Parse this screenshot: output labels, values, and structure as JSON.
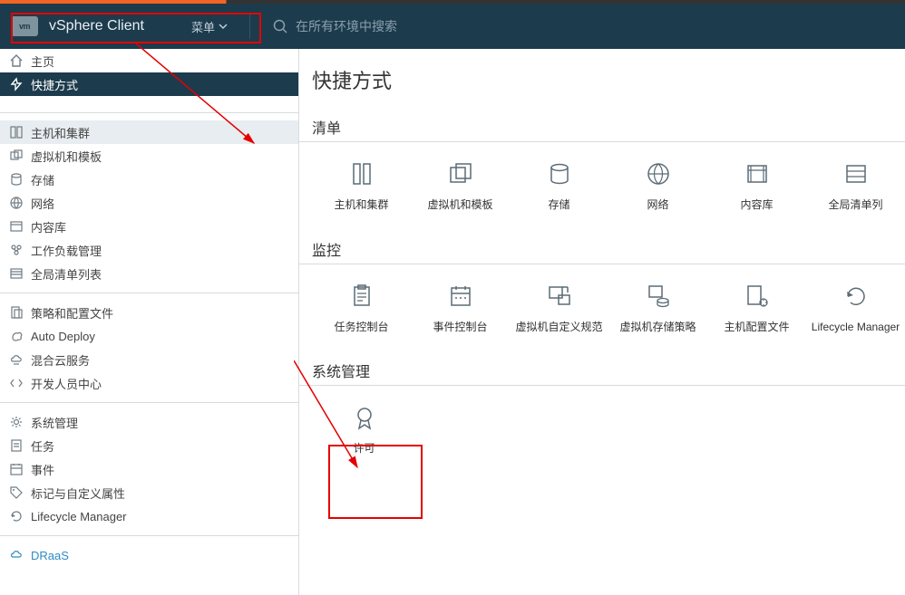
{
  "header": {
    "logo_text": "vm",
    "brand": "vSphere Client",
    "menu_label": "菜单",
    "search_placeholder": "在所有环境中搜索"
  },
  "sidebar": {
    "home": "主页",
    "shortcuts": "快捷方式",
    "hosts": "主机和集群",
    "vms": "虚拟机和模板",
    "storage": "存储",
    "network": "网络",
    "contentlib": "内容库",
    "workload": "工作负载管理",
    "globallists": "全局清单列表",
    "policies": "策略和配置文件",
    "autodeploy": "Auto Deploy",
    "hybrid": "混合云服务",
    "devcenter": "开发人员中心",
    "sysadmin": "系统管理",
    "tasks": "任务",
    "events": "事件",
    "tags": "标记与自定义属性",
    "lifecycle": "Lifecycle Manager",
    "draas": "DRaaS"
  },
  "main": {
    "title": "快捷方式",
    "section_inventory": "清单",
    "section_monitor": "监控",
    "section_admin": "系统管理",
    "tiles_inventory": {
      "hosts": "主机和集群",
      "vms": "虚拟机和模板",
      "storage": "存储",
      "network": "网络",
      "contentlib": "内容库",
      "globallists": "全局清单列"
    },
    "tiles_monitor": {
      "taskconsole": "任务控制台",
      "eventconsole": "事件控制台",
      "vmcustom": "虚拟机自定义规范",
      "vmstorage": "虚拟机存储策略",
      "hostprofile": "主机配置文件",
      "lifecycle": "Lifecycle Manager"
    },
    "tiles_admin": {
      "license": "许可"
    }
  }
}
